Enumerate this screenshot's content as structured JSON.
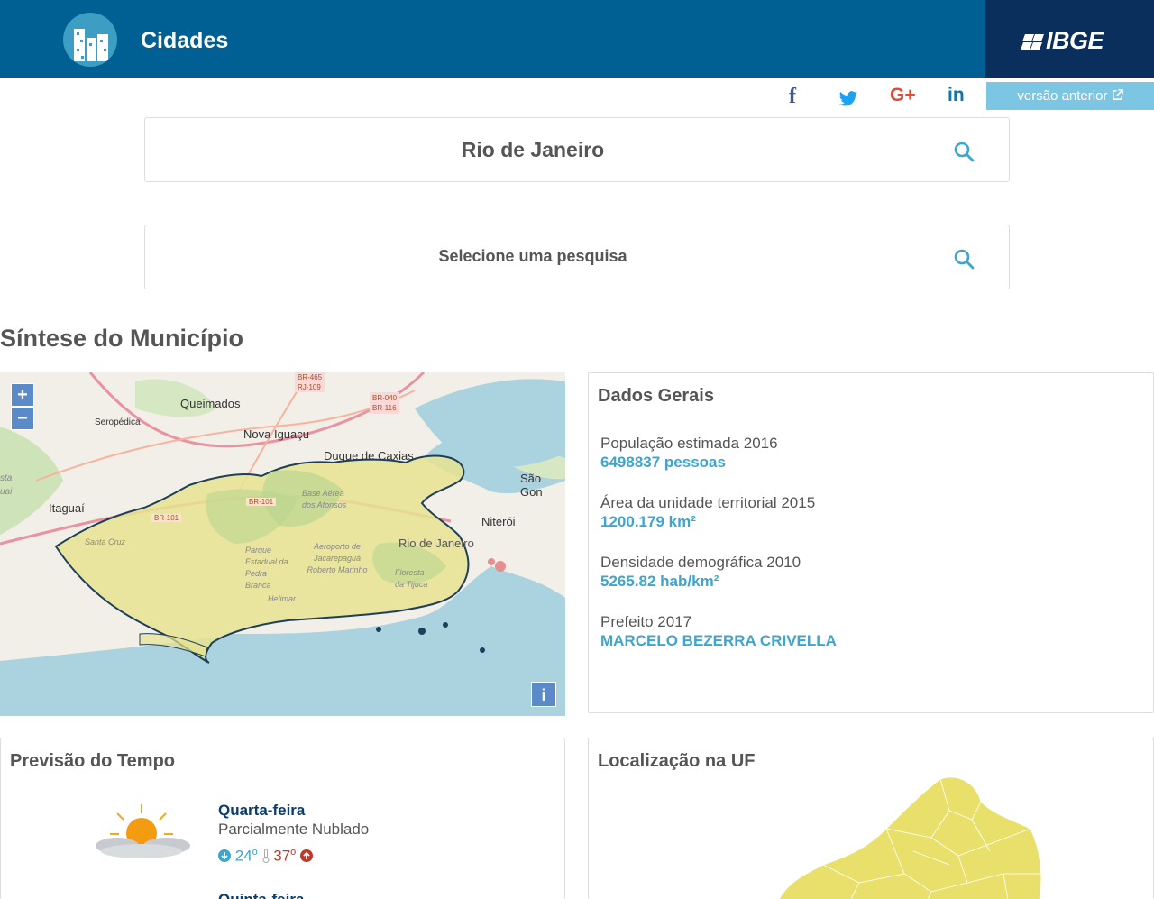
{
  "header": {
    "title": "Cidades",
    "brand": "IBGE"
  },
  "social": {
    "facebook": "f",
    "twitter": "twitter-icon",
    "googleplus": "G+",
    "linkedin": "in",
    "old_version_label": "versão anterior"
  },
  "search": {
    "city_value": "Rio de Janeiro",
    "survey_placeholder": "Selecione uma pesquisa"
  },
  "section": {
    "title": "Síntese do Município"
  },
  "map": {
    "zoom_in": "+",
    "zoom_out": "−",
    "info": "i",
    "labels": [
      "Queimados",
      "Seropédica",
      "Nova Iguaçu",
      "Duque de Caxias",
      "Itaguaí",
      "Niterói",
      "São Gon",
      "Rio de Janeiro",
      "Santa Cruz",
      "Parque Estadual da Pedra Branca",
      "Aeroporto de Jacarepaguá Roberto Marinho",
      "Floresta da Tijuca",
      "Base Aérea dos Afonsos",
      "Helimar",
      "BR-101",
      "BR-040",
      "BR-116",
      "RJ-109",
      "BR-465",
      "sta",
      "uai"
    ]
  },
  "dados_gerais": {
    "title": "Dados Gerais",
    "items": [
      {
        "label": "População estimada 2016",
        "value": "6498837 pessoas"
      },
      {
        "label": "Área da unidade territorial 2015",
        "value": "1200.179 km²"
      },
      {
        "label": "Densidade demográfica 2010",
        "value": "5265.82 hab/km²"
      },
      {
        "label": "Prefeito 2017",
        "value": "MARCELO BEZERRA CRIVELLA"
      }
    ]
  },
  "previsao": {
    "title": "Previsão do Tempo",
    "days": [
      {
        "name": "Quarta-feira",
        "desc": "Parcialmente Nublado",
        "min": "24",
        "max": "37",
        "unit": "o"
      },
      {
        "name": "Quinta-feira"
      }
    ]
  },
  "localizacao": {
    "title": "Localização na UF"
  },
  "colors": {
    "header_bg": "#005f93",
    "brand_bg": "#0b2f5c",
    "accent": "#3ea5cd",
    "max_temp": "#c0392b"
  }
}
